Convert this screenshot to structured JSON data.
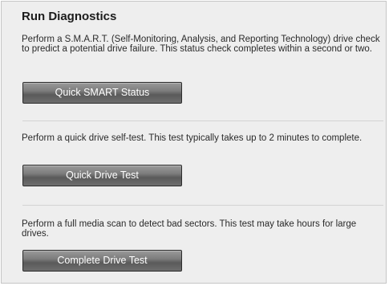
{
  "section": {
    "title": "Run Diagnostics"
  },
  "tests": [
    {
      "description": "Perform a S.M.A.R.T. (Self-Monitoring, Analysis, and Reporting Technology) drive check to predict a potential drive failure. This status check completes within a second or two.",
      "button_label": "Quick SMART Status"
    },
    {
      "description": "Perform a quick drive self-test. This test typically takes up to 2 minutes to complete.",
      "button_label": "Quick Drive Test"
    },
    {
      "description": "Perform a full media scan to detect bad sectors. This test may take hours for large drives.",
      "button_label": "Complete Drive Test"
    }
  ]
}
